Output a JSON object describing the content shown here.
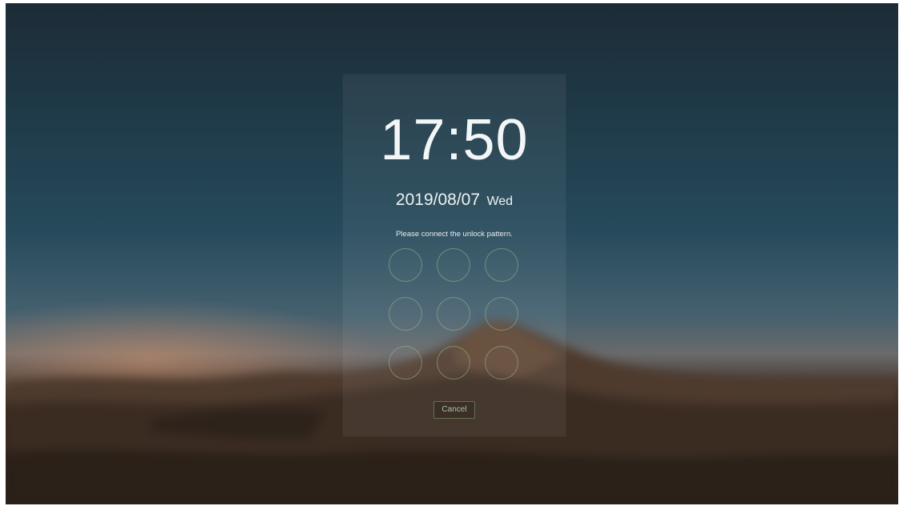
{
  "lockscreen": {
    "time": "17:50",
    "date": "2019/08/07",
    "weekday": "Wed",
    "prompt": "Please connect the unlock pattern.",
    "cancel_label": "Cancel",
    "pattern_dots": 9,
    "accent_color": "#8fb27e"
  }
}
